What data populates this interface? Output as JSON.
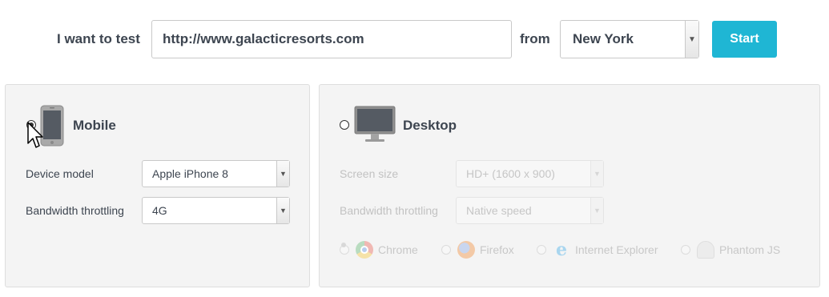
{
  "topbar": {
    "test_label": "I want to test",
    "url_value": "http://www.galacticresorts.com",
    "from_label": "from",
    "location": "New York",
    "start_label": "Start"
  },
  "mobile": {
    "heading": "Mobile",
    "selected": true,
    "icon": "phone-icon",
    "device_label": "Device model",
    "device_value": "Apple iPhone 8",
    "bandwidth_label": "Bandwidth throttling",
    "bandwidth_value": "4G"
  },
  "desktop": {
    "heading": "Desktop",
    "selected": false,
    "icon": "monitor-icon",
    "screen_label": "Screen size",
    "screen_value": "HD+ (1600 x 900)",
    "bandwidth_label": "Bandwidth throttling",
    "bandwidth_value": "Native speed",
    "browsers": [
      {
        "name": "Chrome",
        "icon": "chrome-icon",
        "selected": true
      },
      {
        "name": "Firefox",
        "icon": "firefox-icon",
        "selected": false
      },
      {
        "name": "Internet Explorer",
        "icon": "ie-icon",
        "selected": false
      },
      {
        "name": "Phantom JS",
        "icon": "phantomjs-icon",
        "selected": false
      }
    ]
  },
  "colors": {
    "accent": "#1fb6d4",
    "text": "#3d4550",
    "panel_bg": "#f4f4f4",
    "disabled_text": "#c2c2c2"
  }
}
